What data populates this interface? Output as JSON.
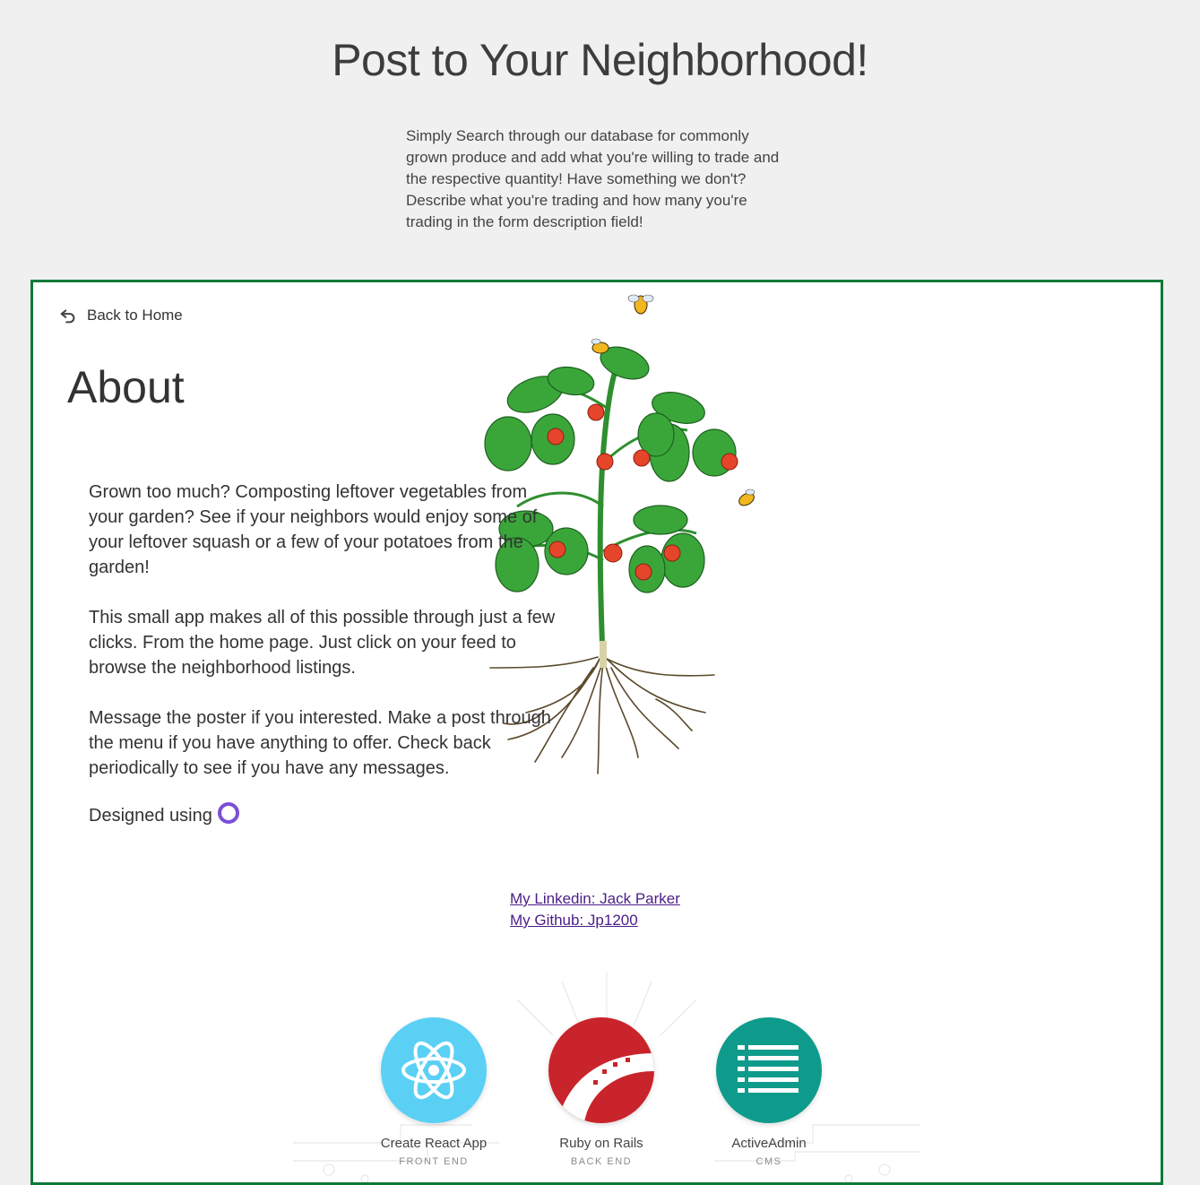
{
  "header": {
    "title": "Post to Your Neighborhood!",
    "intro": "Simply Search through our database for commonly grown produce and add what you're willing to trade and the respective quantity! Have something we don't? Describe what you're trading and how many you're trading in the form description field!"
  },
  "panel": {
    "back_label": "Back to Home",
    "about_title": "About",
    "paragraphs": [
      "Grown too much? Composting leftover vegetables from your garden? See if your neighbors would enjoy some of your leftover squash or a few of your potatoes from the garden!",
      "This small app makes all of this possible through just a few clicks. From the home page. Just click on your feed to browse the neighborhood listings.",
      "Message the poster if you interested. Make a post through the menu if you have anything to offer. Check back periodically to see if you have any messages."
    ],
    "designed_using": "Designed using",
    "links": {
      "linkedin": "My Linkedin: Jack Parker",
      "github": "My Github: Jp1200"
    },
    "stack": [
      {
        "name": "Create React App",
        "role": "FRONT END",
        "color": "#5ad0f5",
        "icon": "react-atom-icon"
      },
      {
        "name": "Ruby on Rails",
        "role": "BACK END",
        "color": "#c9242b",
        "icon": "rails-track-icon"
      },
      {
        "name": "ActiveAdmin",
        "role": "CMS",
        "color": "#0e9b8c",
        "icon": "list-icon"
      }
    ]
  },
  "colors": {
    "panel_border": "#0d7a38",
    "link": "#4b1d86",
    "accent_ring": "#7b4fd6"
  }
}
